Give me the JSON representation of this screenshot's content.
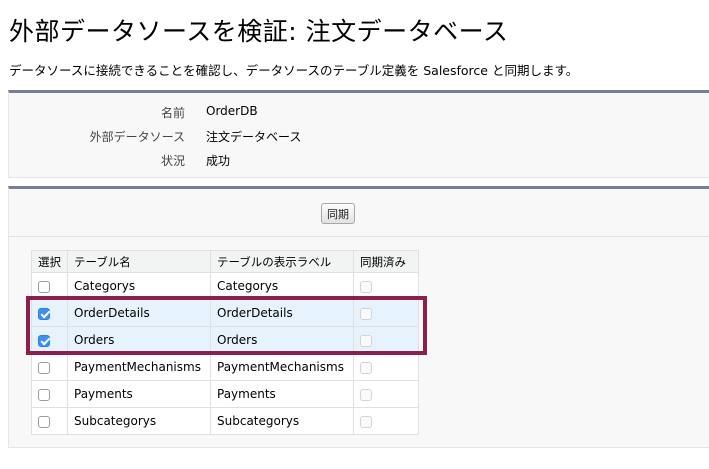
{
  "page": {
    "title": "外部データソースを検証: 注文データベース",
    "description": "データソースに接続できることを確認し、データソースのテーブル定義を Salesforce と同期します。"
  },
  "info": {
    "name_label": "名前",
    "name_value": "OrderDB",
    "source_label": "外部データソース",
    "source_value": "注文データベース",
    "status_label": "状況",
    "status_value": "成功"
  },
  "toolbar": {
    "sync_label": "同期"
  },
  "table": {
    "headers": {
      "select": "選択",
      "table_name": "テーブル名",
      "display_label": "テーブルの表示ラベル",
      "synced": "同期済み"
    },
    "rows": [
      {
        "name": "Categorys",
        "label": "Categorys",
        "selected": false
      },
      {
        "name": "OrderDetails",
        "label": "OrderDetails",
        "selected": true
      },
      {
        "name": "Orders",
        "label": "Orders",
        "selected": true
      },
      {
        "name": "PaymentMechanisms",
        "label": "PaymentMechanisms",
        "selected": false
      },
      {
        "name": "Payments",
        "label": "Payments",
        "selected": false
      },
      {
        "name": "Subcategorys",
        "label": "Subcategorys",
        "selected": false
      }
    ]
  },
  "colors": {
    "panel_border": "#747e96",
    "highlight": "#8c1f4e",
    "checkbox_on": "#3b8ff5",
    "selected_row": "#e6f3fc"
  }
}
